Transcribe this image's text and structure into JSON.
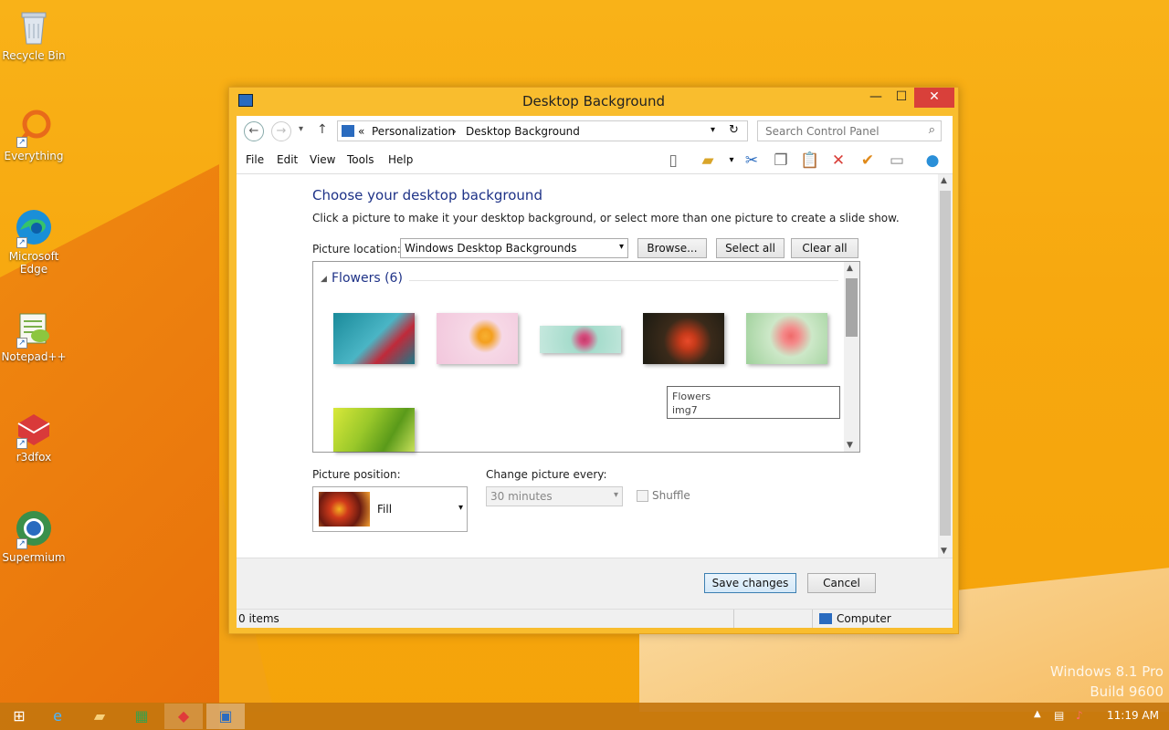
{
  "desktop": {
    "icons": [
      {
        "label": "Recycle Bin",
        "icon": "recycle-bin-icon"
      },
      {
        "label": "Everything",
        "icon": "everything-search-icon"
      },
      {
        "label": "Microsoft Edge",
        "icon": "edge-icon"
      },
      {
        "label": "Notepad++",
        "icon": "notepad-plus-plus-icon"
      },
      {
        "label": "r3dfox",
        "icon": "r3dfox-icon"
      },
      {
        "label": "Supermium",
        "icon": "supermium-icon"
      }
    ],
    "watermark_line1": "Windows 8.1 Pro",
    "watermark_line2": "Build 9600"
  },
  "window": {
    "title": "Desktop Background",
    "close_glyph": "✕",
    "minimize_glyph": "—",
    "maximize_glyph": "☐"
  },
  "address": {
    "prefix": "«",
    "crumb1": "Personalization",
    "sep": "›",
    "crumb2": "Desktop Background",
    "search_placeholder": "Search Control Panel"
  },
  "menu": {
    "file": "File",
    "edit": "Edit",
    "view": "View",
    "tools": "Tools",
    "help": "Help"
  },
  "content": {
    "heading": "Choose your desktop background",
    "description": "Click a picture to make it your desktop background, or select more than one picture to create a slide show.",
    "picture_location_label": "Picture location:",
    "picture_location_value": "Windows Desktop Backgrounds",
    "browse": "Browse...",
    "select_all": "Select all",
    "clear_all": "Clear all",
    "group_title": "Flowers (6)",
    "tooltip_line1": "Flowers",
    "tooltip_line2": "img7",
    "picture_position_label": "Picture position:",
    "picture_position_value": "Fill",
    "change_every_label": "Change picture every:",
    "change_every_value": "30 minutes",
    "shuffle_label": "Shuffle"
  },
  "footer": {
    "save": "Save changes",
    "cancel": "Cancel"
  },
  "status": {
    "items": "0 items",
    "location": "Computer"
  },
  "taskbar": {
    "clock": "11:19 AM"
  }
}
